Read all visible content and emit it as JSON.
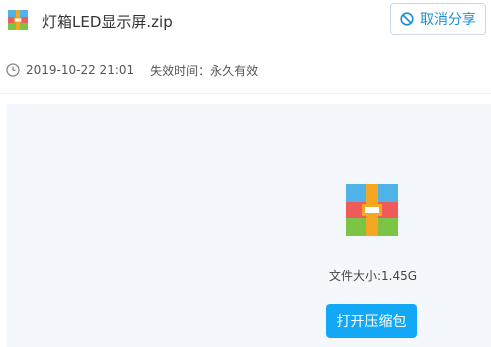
{
  "file": {
    "name": "灯箱LED显示屏.zip",
    "icon": "archive-zip-icon"
  },
  "actions": {
    "cancel_share_label": "取消分享",
    "cancel_share_icon": "ban-icon",
    "open_archive_label": "打开压缩包"
  },
  "meta": {
    "date": "2019-10-22 21:01",
    "expire_label": "失效时间：",
    "expire_value": "永久有效",
    "clock_icon": "clock-icon"
  },
  "preview": {
    "size_label": "文件大小:",
    "size_value": "1.45G"
  },
  "colors": {
    "accent": "#1890d8",
    "button_bg": "#12a8f5",
    "panel_bg": "#f4f8fc"
  }
}
